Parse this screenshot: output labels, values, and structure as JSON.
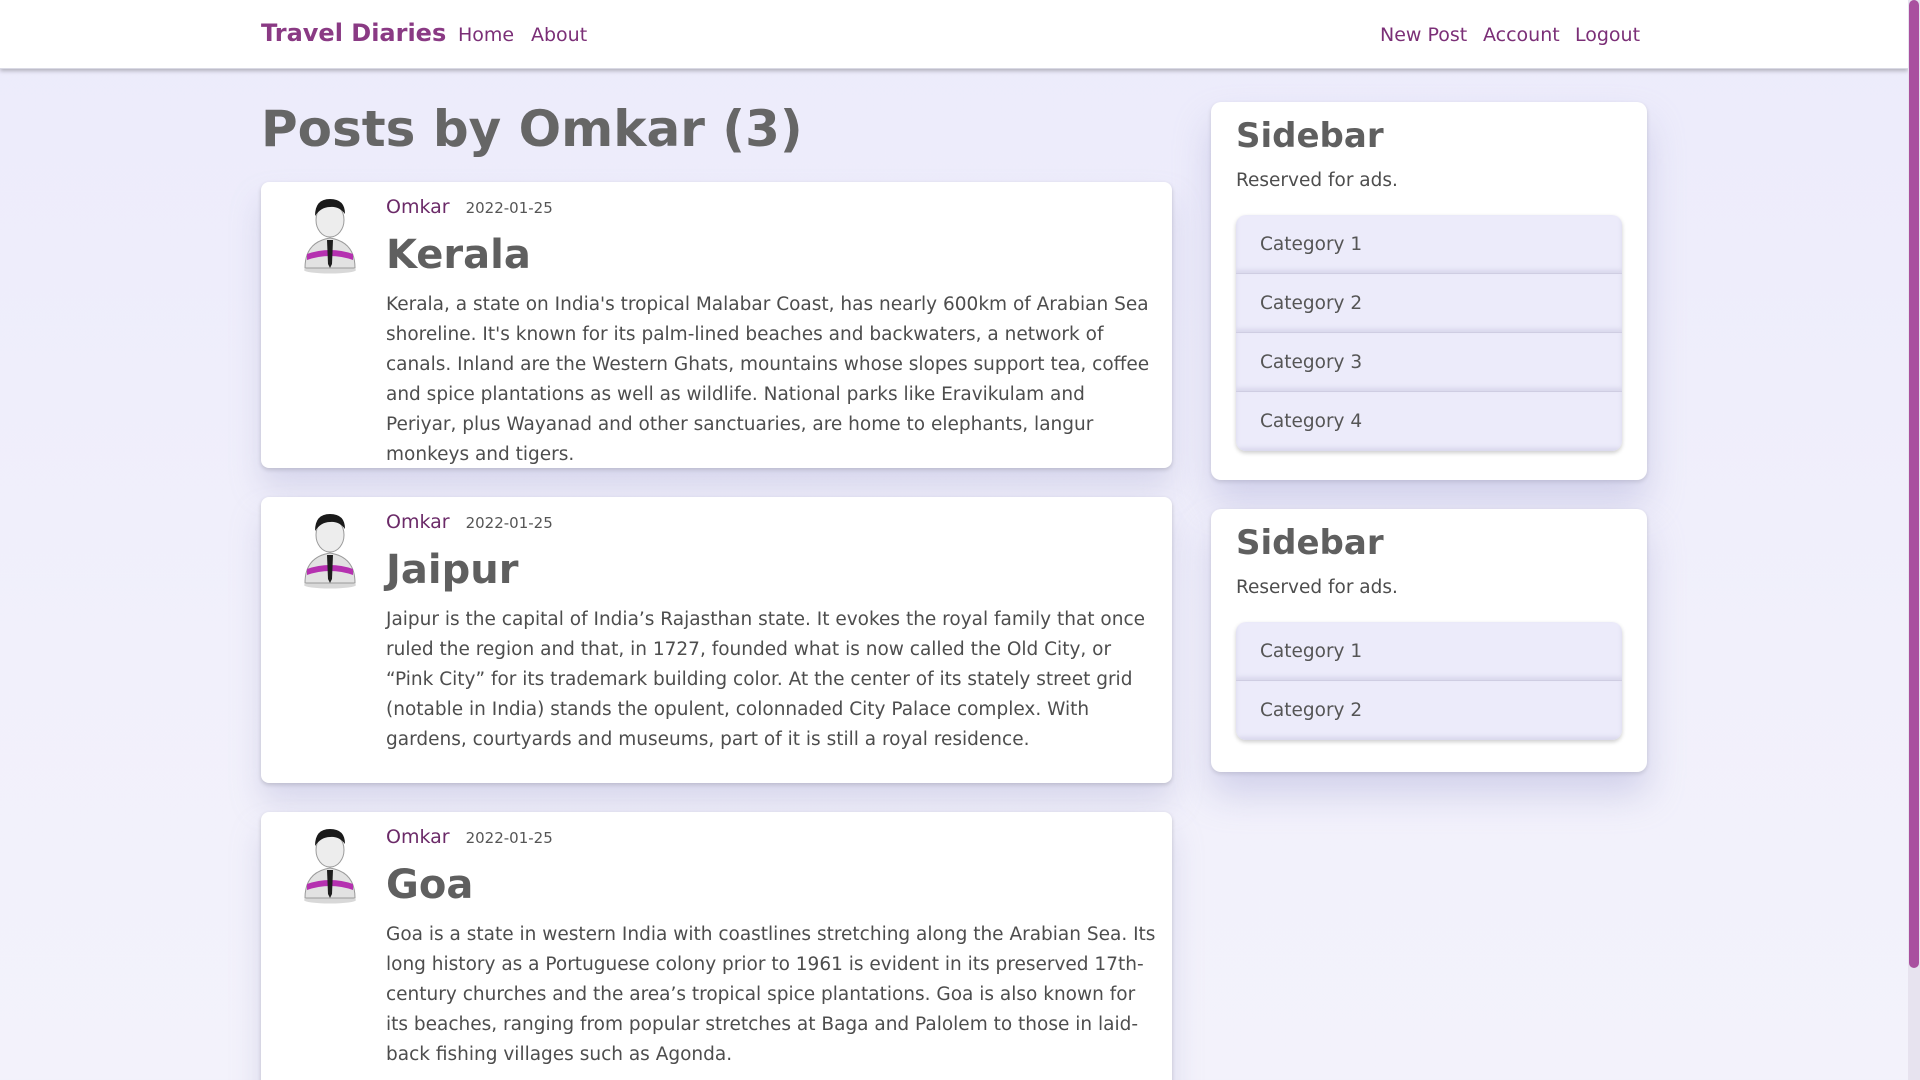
{
  "navbar": {
    "brand": "Travel Diaries",
    "links_left": [
      "Home",
      "About"
    ],
    "links_right": [
      "New Post",
      "Account",
      "Logout"
    ]
  },
  "main": {
    "title": "Posts by Omkar (3)",
    "posts": [
      {
        "author": "Omkar",
        "date": "2022-01-25",
        "title": "Kerala",
        "body": "Kerala, a state on India's tropical Malabar Coast, has nearly 600km of Arabian Sea shoreline. It's known for its palm-lined beaches and backwaters, a network of canals. Inland are the Western Ghats, mountains whose slopes support tea, coffee and spice plantations as well as wildlife. National parks like Eravikulam and Periyar, plus Wayanad and other sanctuaries, are home to elephants, langur monkeys and tigers."
      },
      {
        "author": "Omkar",
        "date": "2022-01-25",
        "title": "Jaipur",
        "body": "Jaipur is the capital of India’s Rajasthan state. It evokes the royal family that once ruled the region and that, in 1727, founded what is now called the Old City, or “Pink City” for its trademark building color. At the center of its stately street grid (notable in India) stands the opulent, colonnaded City Palace complex. With gardens, courtyards and museums, part of it is still a royal residence."
      },
      {
        "author": "Omkar",
        "date": "2022-01-25",
        "title": "Goa",
        "body": "Goa is a state in western India with coastlines stretching along the Arabian Sea. Its long history as a Portuguese colony prior to 1961 is evident in its preserved 17th-century churches and the area’s tropical spice plantations. Goa is also known for its beaches, ranging from popular stretches at Baga and Palolem to those in laid-back fishing villages such as Agonda."
      }
    ]
  },
  "sidebars": [
    {
      "title": "Sidebar",
      "text": "Reserved for ads.",
      "items": [
        "Category 1",
        "Category 2",
        "Category 3",
        "Category 4"
      ]
    },
    {
      "title": "Sidebar",
      "text": "Reserved for ads.",
      "items": [
        "Category 1",
        "Category 2"
      ]
    }
  ],
  "icons": {
    "avatar": "user-avatar-icon"
  },
  "colors": {
    "brand": "#8a3a84",
    "link": "#7b2f77",
    "background": "#ecebfb",
    "list_item_bg": "#ecebfa",
    "scrollbar_thumb": "#a9509f"
  }
}
